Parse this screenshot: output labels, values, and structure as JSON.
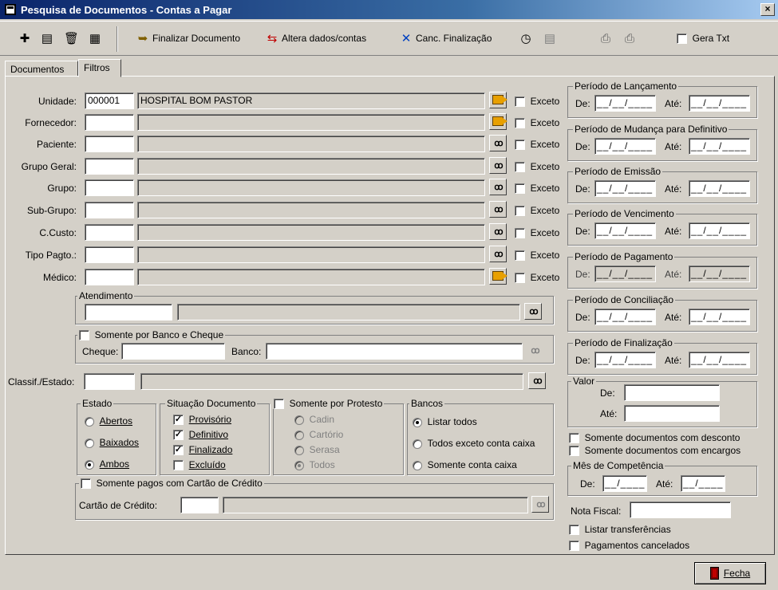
{
  "window": {
    "title": "Pesquisa de Documentos - Contas a Pagar",
    "close": "×"
  },
  "toolbar": {
    "finalizar": "Finalizar Documento",
    "altera": "Altera dados/contas",
    "canc": "Canc. Finalização",
    "gera_txt": "Gera Txt",
    "gera_txt_checked": false
  },
  "tabs": [
    "Documentos",
    "Filtros"
  ],
  "active_tab": "Filtros",
  "exceto_label": "Exceto",
  "filters": [
    {
      "label": "Unidade:",
      "code": "000001",
      "name": "HOSPITAL BOM PASTOR",
      "icon": "arrow"
    },
    {
      "label": "Fornecedor:",
      "code": "",
      "name": "",
      "icon": "arrow"
    },
    {
      "label": "Paciente:",
      "code": "",
      "name": "",
      "icon": "binoculars"
    },
    {
      "label": "Grupo Geral:",
      "code": "",
      "name": "",
      "icon": "binoculars"
    },
    {
      "label": "Grupo:",
      "code": "",
      "name": "",
      "icon": "binoculars"
    },
    {
      "label": "Sub-Grupo:",
      "code": "",
      "name": "",
      "icon": "binoculars"
    },
    {
      "label": "C.Custo:",
      "code": "",
      "name": "",
      "icon": "binoculars"
    },
    {
      "label": "Tipo Pagto.:",
      "code": "",
      "name": "",
      "icon": "binoculars"
    },
    {
      "label": "Médico:",
      "code": "",
      "name": "",
      "icon": "arrow"
    }
  ],
  "atendimento": {
    "caption": "Atendimento",
    "code": "",
    "name": ""
  },
  "banco_cheque": {
    "caption": "Somente por Banco e Cheque",
    "cheque_label": "Cheque:",
    "banco_label": "Banco:",
    "cheque": "",
    "banco": ""
  },
  "classif": {
    "label": "Classif./Estado:",
    "code": "",
    "name": ""
  },
  "estado": {
    "caption": "Estado",
    "options": [
      "Abertos",
      "Baixados",
      "Ambos"
    ],
    "selected": "Ambos"
  },
  "situacao": {
    "caption": "Situação Documento",
    "options": [
      {
        "label": "Provisório",
        "checked": true
      },
      {
        "label": "Definitivo",
        "checked": true
      },
      {
        "label": "Finalizado",
        "checked": true
      },
      {
        "label": "Excluído",
        "checked": false
      }
    ]
  },
  "protesto": {
    "caption": "Somente por Protesto",
    "options": [
      "Cadin",
      "Cartório",
      "Serasa",
      "Todos"
    ],
    "selected": "Todos"
  },
  "bancos": {
    "caption": "Bancos",
    "options": [
      "Listar todos",
      "Todos exceto conta caixa",
      "Somente conta caixa"
    ],
    "selected": "Listar todos"
  },
  "cartao": {
    "caption": "Somente pagos com Cartão de Crédito",
    "label": "Cartão de Crédito:",
    "code": "",
    "name": ""
  },
  "periodos": [
    {
      "caption": "Período de Lançamento",
      "enabled": true
    },
    {
      "caption": "Período de Mudança para Definitivo",
      "enabled": true
    },
    {
      "caption": "Período de Emissão",
      "enabled": true
    },
    {
      "caption": "Período de Vencimento",
      "enabled": true
    },
    {
      "caption": "Período de Pagamento",
      "enabled": false
    },
    {
      "caption": "Período de Conciliação",
      "enabled": true
    },
    {
      "caption": "Período de Finalização",
      "enabled": true
    }
  ],
  "de_label": "De:",
  "ate_label": "Até:",
  "date_mask": "__/__/____",
  "valor": {
    "caption": "Valor",
    "de": "De:",
    "ate": "Até:"
  },
  "somente_desconto": "Somente documentos com desconto",
  "somente_encargos": "Somente documentos com encargos",
  "mes_competencia": {
    "caption": "Mês de Competência",
    "de": "De:",
    "ate": "Até:",
    "mask": "__/____"
  },
  "nota_fiscal": {
    "label": "Nota Fiscal:",
    "value": ""
  },
  "listar_transferencias": "Listar transferências",
  "pagamentos_cancelados": "Pagamentos cancelados",
  "fecha": "Fecha"
}
